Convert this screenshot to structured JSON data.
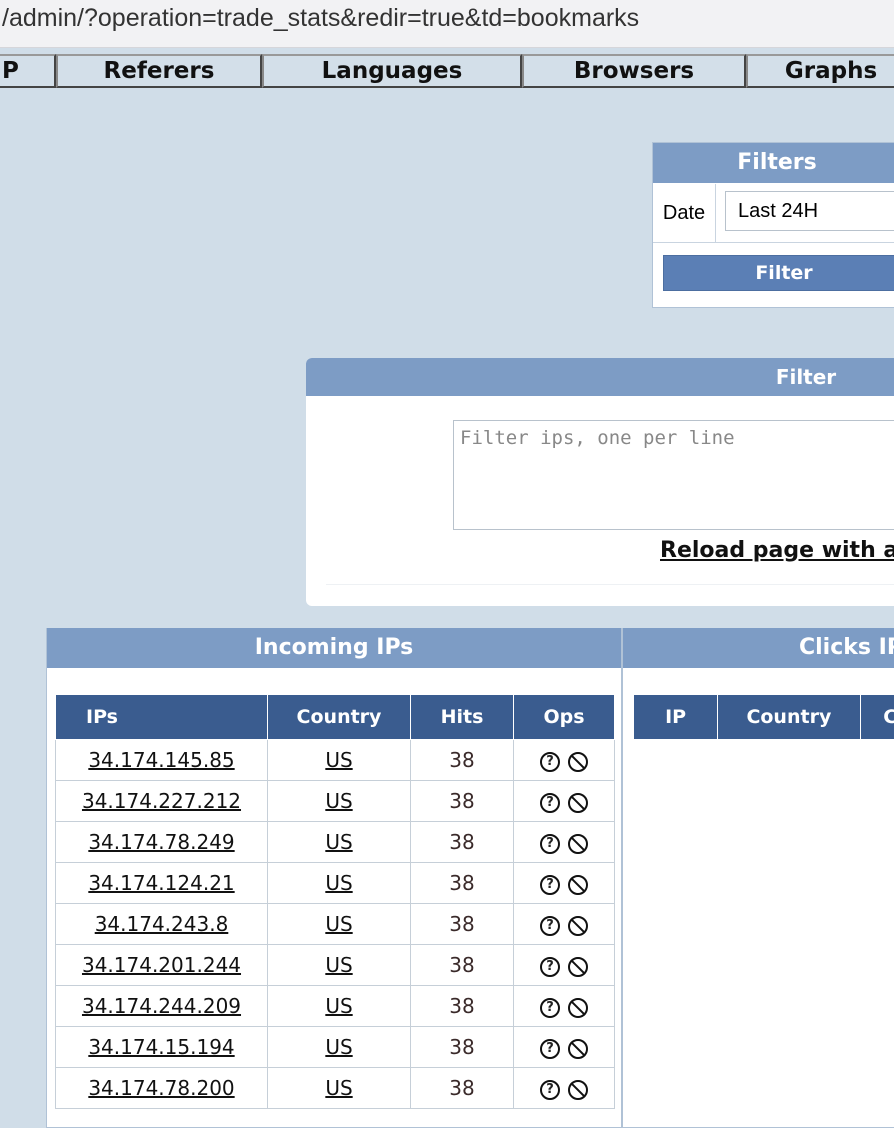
{
  "url": "/admin/?operation=trade_stats&redir=true&td=bookmarks",
  "nav_tabs": [
    "P",
    "Referers",
    "Languages",
    "Browsers",
    "Graphs"
  ],
  "filters_box": {
    "title": "Filters",
    "date_label": "Date",
    "date_value": "Last 24H",
    "button_label": "Filter"
  },
  "ip_filter": {
    "title": "Filter",
    "placeholder": "Filter ips, one per line",
    "reload_link": "Reload page with al"
  },
  "incoming": {
    "title": "Incoming IPs",
    "columns": [
      "IPs",
      "Country",
      "Hits",
      "Ops"
    ],
    "rows": [
      {
        "ip": "34.174.145.85",
        "country": "US",
        "hits": "38"
      },
      {
        "ip": "34.174.227.212",
        "country": "US",
        "hits": "38"
      },
      {
        "ip": "34.174.78.249",
        "country": "US",
        "hits": "38"
      },
      {
        "ip": "34.174.124.21",
        "country": "US",
        "hits": "38"
      },
      {
        "ip": "34.174.243.8",
        "country": "US",
        "hits": "38"
      },
      {
        "ip": "34.174.201.244",
        "country": "US",
        "hits": "38"
      },
      {
        "ip": "34.174.244.209",
        "country": "US",
        "hits": "38"
      },
      {
        "ip": "34.174.15.194",
        "country": "US",
        "hits": "38"
      },
      {
        "ip": "34.174.78.200",
        "country": "US",
        "hits": "38"
      }
    ],
    "ops_icons": [
      "question-circle-icon",
      "ban-icon"
    ]
  },
  "clicks": {
    "title": "Clicks IP",
    "columns": [
      "IP",
      "Country",
      "C"
    ]
  },
  "colors": {
    "page_bg": "#d0dde8",
    "box_header": "#7d9cc5",
    "table_header": "#3a5c8f",
    "button": "#5b7fb5"
  }
}
